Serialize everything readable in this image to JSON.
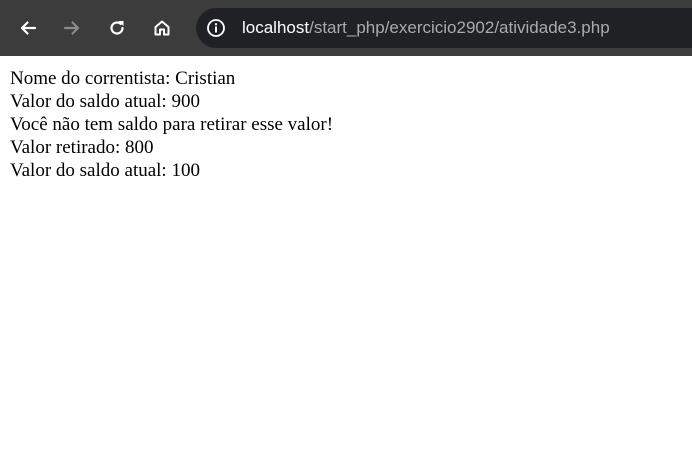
{
  "browser": {
    "url_host": "localhost",
    "url_path": "/start_php/exercicio2902/atividade3.php",
    "icons": {
      "back": "arrow-left-icon",
      "forward": "arrow-right-icon",
      "reload": "reload-icon",
      "home": "home-icon",
      "info": "info-icon"
    }
  },
  "page": {
    "lines": [
      "Nome do correntista: Cristian",
      "Valor do saldo atual: 900",
      "Você não tem saldo para retirar esse valor!",
      "Valor retirado: 800",
      "Valor do saldo atual: 100"
    ]
  },
  "colors": {
    "toolbar": "#3c3c3c",
    "omnibox": "#202124",
    "page_background": "#ffffff",
    "text": "#000000"
  }
}
